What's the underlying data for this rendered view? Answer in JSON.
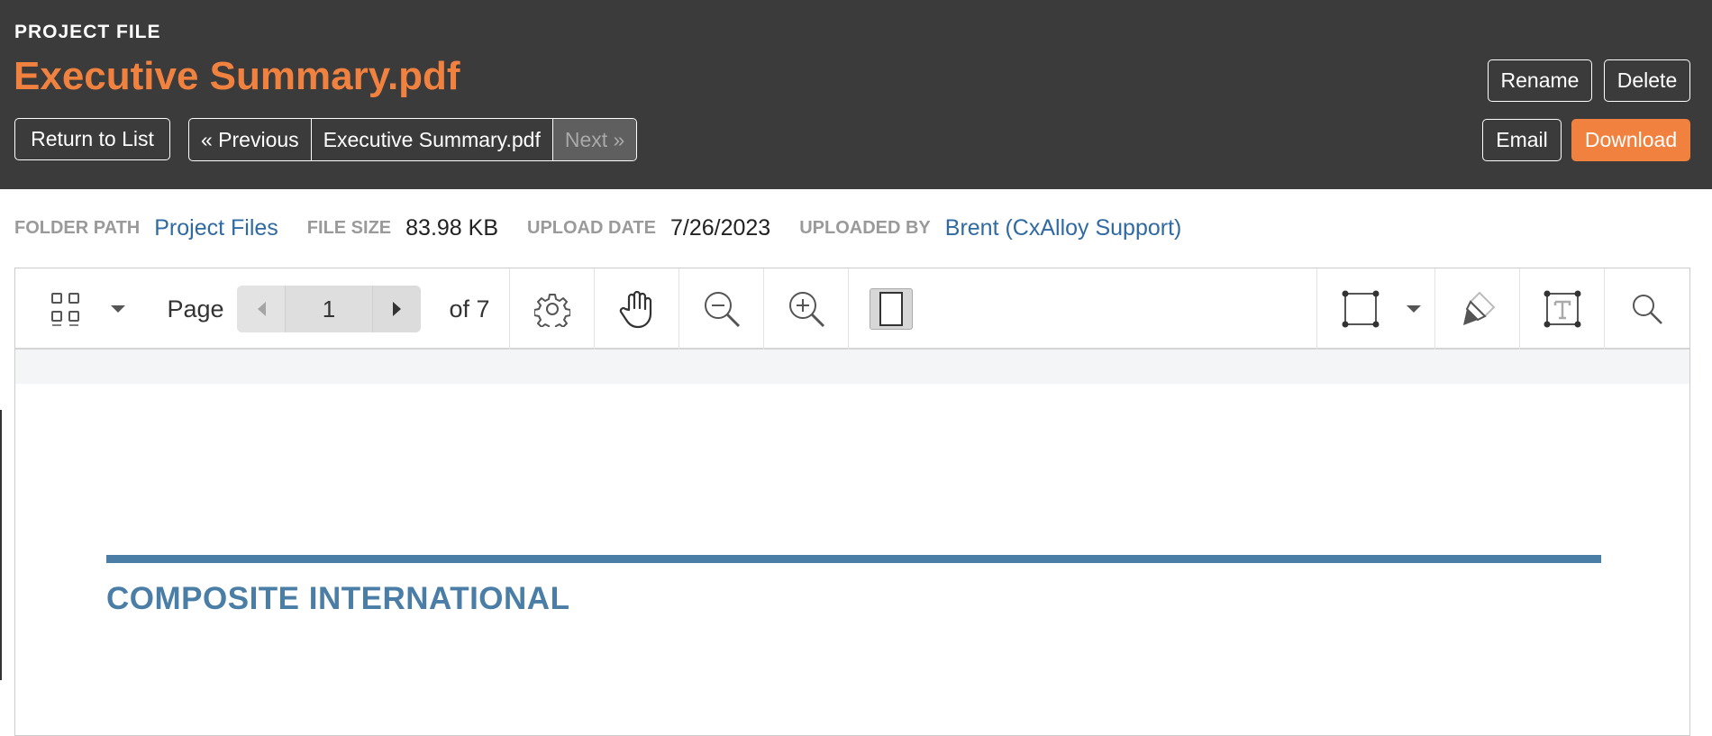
{
  "header": {
    "eyebrow": "PROJECT FILE",
    "title": "Executive Summary.pdf",
    "rename_label": "Rename",
    "delete_label": "Delete",
    "return_label": "Return to List",
    "previous_label": "« Previous",
    "current_file_label": "Executive Summary.pdf",
    "next_label": "Next »",
    "email_label": "Email",
    "download_label": "Download"
  },
  "meta": {
    "folder_path_label": "FOLDER PATH",
    "folder_path_value": "Project Files",
    "file_size_label": "FILE SIZE",
    "file_size_value": "83.98 KB",
    "upload_date_label": "UPLOAD DATE",
    "upload_date_value": "7/26/2023",
    "uploaded_by_label": "UPLOADED BY",
    "uploaded_by_value": "Brent (CxAlloy Support)"
  },
  "toolbar": {
    "page_label": "Page",
    "current_page": "1",
    "of_label": "of 7",
    "icons": [
      "thumbnails-icon",
      "chevron-down-icon",
      "gear-icon",
      "hand-icon",
      "zoom-out-icon",
      "zoom-in-icon",
      "single-page-icon",
      "rectangle-select-icon",
      "chevron-down-icon",
      "highlighter-icon",
      "text-box-icon",
      "search-icon"
    ]
  },
  "document": {
    "heading": "COMPOSITE INTERNATIONAL"
  },
  "colors": {
    "header_bg": "#3b3b3b",
    "accent_orange": "#f0813f",
    "link_blue": "#2f6aa3",
    "doc_blue": "#4a7ea6"
  }
}
